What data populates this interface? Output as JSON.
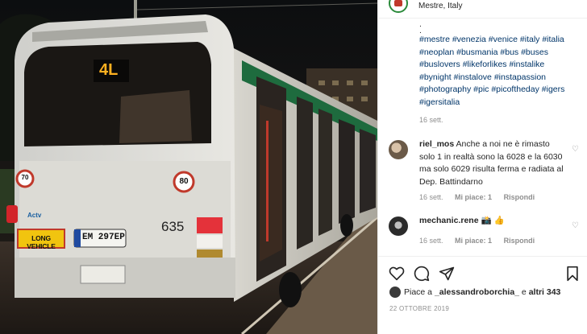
{
  "header": {
    "location": "Mestre, Italy"
  },
  "caption": {
    "dots": [
      ".",
      "."
    ],
    "hashtag_lines": [
      "#mestre #venezia #venice #italy #italia",
      "#neoplan #busmania #bus #buses",
      "#buslovers #likeforlikes #instalike",
      "#bynight #instalove #instapassion",
      "#photography #pic #picoftheday #igers",
      "#igersitalia"
    ],
    "time": "16 sett."
  },
  "comments": [
    {
      "user": "riel_mos",
      "text": "Anche a noi ne è rimasto solo 1 in realtà sono la 6028 e la 6030 ma solo 6029 risulta ferma e radiata al Dep. Battindarno",
      "time": "16 sett.",
      "likes": "Mi piace: 1",
      "reply": "Rispondi"
    },
    {
      "user": "mechanic.rene",
      "text": "📸 👍",
      "time": "16 sett.",
      "likes": "Mi piace: 1",
      "reply": "Rispondi"
    }
  ],
  "likes": {
    "prefix": "Piace a ",
    "user": "_alessandroborchia_",
    "middle": " e ",
    "others": "altri 343"
  },
  "post_date": "22 OTTOBRE 2019",
  "photo": {
    "route_display": "4L",
    "fleet_number": "635",
    "plate": "EM 297EP",
    "long_vehicle": "LONG VEHICLE",
    "speed_left": "70",
    "speed_right": "80",
    "logo": "Actv"
  },
  "colors": {
    "hashtag": "#003569",
    "text": "#262626",
    "muted": "#8e8e8e"
  }
}
